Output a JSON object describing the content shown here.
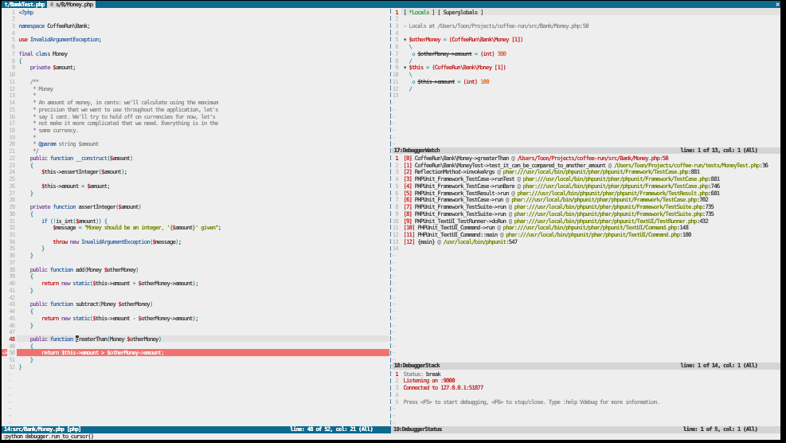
{
  "colors": {
    "accent_blue_bar": "#0d6a8f",
    "editor_bg": "#eeeeee",
    "cursorline_bg": "#e2e2e2",
    "break_line_bg": "#f0716f",
    "inactive_bar_bg": "#d5d5d5",
    "text_fg": "#4a4a4b",
    "comment_gray": "#8e908c",
    "red": "#c82829",
    "green": "#718c00",
    "locals_green": "#35a14b",
    "blue": "#4271ae",
    "purple": "#8959a8",
    "aqua": "#3e99ae",
    "orange": "#e0702d",
    "line_number": "#aeaeae",
    "nontext_tilde": "#b9c2ea",
    "vert_split": "#4e81a0",
    "tree_branch": "#5b8cc4"
  },
  "tabline": {
    "tabs": [
      {
        "label": "t/BankTest.php",
        "active": false
      },
      {
        "win_count": "4",
        "label": "s/B/Money.php",
        "active": true
      }
    ],
    "close_label": "X"
  },
  "code_window": {
    "cursor_line": 48,
    "break_line": 50,
    "tilde_rows": 8,
    "lines": [
      [
        [
          "blu",
          "<?php"
        ]
      ],
      [],
      [
        [
          "blu",
          "namespace"
        ],
        [
          "fg",
          " CoffeeRun\\Bank;"
        ]
      ],
      [],
      [
        [
          "red",
          "use"
        ],
        [
          "blu",
          " InvalidArgumentException"
        ],
        [
          "fg",
          ";"
        ]
      ],
      [],
      [
        [
          "pur",
          "final "
        ],
        [
          "blu",
          "class"
        ],
        [
          "fg",
          " Money"
        ]
      ],
      [
        [
          "aqu",
          "{"
        ]
      ],
      [
        [
          "fg",
          "    "
        ],
        [
          "pur",
          "private"
        ],
        [
          "fg",
          " "
        ],
        [
          "red",
          "$"
        ],
        [
          "fg",
          "amount;"
        ]
      ],
      [],
      [
        [
          "com",
          "    /**"
        ]
      ],
      [
        [
          "com",
          "     * Money"
        ]
      ],
      [
        [
          "com",
          "     *"
        ]
      ],
      [
        [
          "com",
          "     * An amount of money, in cents: we'll calculate using the maximum"
        ]
      ],
      [
        [
          "com",
          "     * precision that we want to use throughout the application, let's"
        ]
      ],
      [
        [
          "com",
          "     * say 1 cent. We'll try to hold off on currencies for now, let's"
        ]
      ],
      [
        [
          "com",
          "     * not make it more complicated that we need. Everything is in the"
        ]
      ],
      [
        [
          "com",
          "     * same currency."
        ]
      ],
      [
        [
          "com",
          "     *"
        ]
      ],
      [
        [
          "com",
          "     * "
        ],
        [
          "blu",
          "@param"
        ],
        [
          "com",
          " string $amount"
        ]
      ],
      [
        [
          "com",
          "     */"
        ]
      ],
      [
        [
          "fg",
          "    "
        ],
        [
          "pur",
          "public"
        ],
        [
          "fg",
          " "
        ],
        [
          "blu",
          "function __construct"
        ],
        [
          "aqu",
          "("
        ],
        [
          "red",
          "$"
        ],
        [
          "fg",
          "amount"
        ],
        [
          "aqu",
          ")"
        ]
      ],
      [
        [
          "fg",
          "    "
        ],
        [
          "aqu",
          "{"
        ]
      ],
      [
        [
          "fg",
          "        "
        ],
        [
          "red",
          "$"
        ],
        [
          "fg",
          "this->assertInteger"
        ],
        [
          "aqu",
          "("
        ],
        [
          "red",
          "$"
        ],
        [
          "fg",
          "amount"
        ],
        [
          "aqu",
          ")"
        ],
        [
          "fg",
          ";"
        ]
      ],
      [],
      [
        [
          "fg",
          "        "
        ],
        [
          "red",
          "$"
        ],
        [
          "fg",
          "this->amount"
        ],
        [
          "aqu",
          " = "
        ],
        [
          "red",
          "$"
        ],
        [
          "fg",
          "amount;"
        ]
      ],
      [
        [
          "fg",
          "    "
        ],
        [
          "aqu",
          "}"
        ]
      ],
      [],
      [
        [
          "fg",
          "    "
        ],
        [
          "pur",
          "private"
        ],
        [
          "fg",
          " "
        ],
        [
          "blu",
          "function"
        ],
        [
          "fg",
          " assertInteger"
        ],
        [
          "aqu",
          "("
        ],
        [
          "red",
          "$"
        ],
        [
          "fg",
          "amount"
        ],
        [
          "aqu",
          ")"
        ]
      ],
      [
        [
          "fg",
          "    "
        ],
        [
          "aqu",
          "{"
        ]
      ],
      [
        [
          "fg",
          "        "
        ],
        [
          "blu",
          "if"
        ],
        [
          "fg",
          " "
        ],
        [
          "aqu",
          "(!"
        ],
        [
          "fg",
          "is_int"
        ],
        [
          "aqu",
          "("
        ],
        [
          "red",
          "$"
        ],
        [
          "fg",
          "amount"
        ],
        [
          "aqu",
          "))"
        ],
        [
          "fg",
          " "
        ],
        [
          "aqu",
          "{"
        ]
      ],
      [
        [
          "fg",
          "            "
        ],
        [
          "red",
          "$"
        ],
        [
          "fg",
          "message"
        ],
        [
          "aqu",
          " = "
        ],
        [
          "grn",
          "\"Money should be an integer, '{"
        ],
        [
          "red",
          "$"
        ],
        [
          "fg",
          "amount"
        ],
        [
          "grn",
          "}' given\""
        ],
        [
          "fg",
          ";"
        ]
      ],
      [],
      [
        [
          "fg",
          "            "
        ],
        [
          "red",
          "throw"
        ],
        [
          "fg",
          " "
        ],
        [
          "pur",
          "new"
        ],
        [
          "fg",
          " "
        ],
        [
          "blu",
          "InvalidArgumentException"
        ],
        [
          "aqu",
          "("
        ],
        [
          "red",
          "$"
        ],
        [
          "fg",
          "message"
        ],
        [
          "aqu",
          ")"
        ],
        [
          "fg",
          ";"
        ]
      ],
      [
        [
          "fg",
          "        "
        ],
        [
          "aqu",
          "}"
        ]
      ],
      [
        [
          "fg",
          "    "
        ],
        [
          "aqu",
          "}"
        ]
      ],
      [],
      [
        [
          "fg",
          "    "
        ],
        [
          "pur",
          "public"
        ],
        [
          "fg",
          " "
        ],
        [
          "blu",
          "function"
        ],
        [
          "fg",
          " add"
        ],
        [
          "aqu",
          "("
        ],
        [
          "fg",
          "Money "
        ],
        [
          "red",
          "$"
        ],
        [
          "fg",
          "otherMoney"
        ],
        [
          "aqu",
          ")"
        ]
      ],
      [
        [
          "fg",
          "    "
        ],
        [
          "aqu",
          "{"
        ]
      ],
      [
        [
          "fg",
          "        "
        ],
        [
          "red",
          "return"
        ],
        [
          "fg",
          " "
        ],
        [
          "pur",
          "new"
        ],
        [
          "fg",
          " "
        ],
        [
          "blu",
          "static"
        ],
        [
          "aqu",
          "("
        ],
        [
          "red",
          "$"
        ],
        [
          "fg",
          "this->amount"
        ],
        [
          "aqu",
          " + "
        ],
        [
          "red",
          "$"
        ],
        [
          "fg",
          "otherMoney->amount"
        ],
        [
          "aqu",
          ")"
        ],
        [
          "fg",
          ";"
        ]
      ],
      [
        [
          "fg",
          "    "
        ],
        [
          "aqu",
          "}"
        ]
      ],
      [],
      [
        [
          "fg",
          "    "
        ],
        [
          "pur",
          "public"
        ],
        [
          "fg",
          " "
        ],
        [
          "blu",
          "function"
        ],
        [
          "fg",
          " subtract"
        ],
        [
          "aqu",
          "("
        ],
        [
          "fg",
          "Money "
        ],
        [
          "red",
          "$"
        ],
        [
          "fg",
          "otherMoney"
        ],
        [
          "aqu",
          ")"
        ]
      ],
      [
        [
          "fg",
          "    "
        ],
        [
          "aqu",
          "{"
        ]
      ],
      [
        [
          "fg",
          "        "
        ],
        [
          "red",
          "return"
        ],
        [
          "fg",
          " "
        ],
        [
          "pur",
          "new"
        ],
        [
          "fg",
          " "
        ],
        [
          "blu",
          "static"
        ],
        [
          "aqu",
          "("
        ],
        [
          "red",
          "$"
        ],
        [
          "fg",
          "this->amount"
        ],
        [
          "aqu",
          " - "
        ],
        [
          "red",
          "$"
        ],
        [
          "fg",
          "otherMoney->amount"
        ],
        [
          "aqu",
          ")"
        ],
        [
          "fg",
          ";"
        ]
      ],
      [
        [
          "fg",
          "    "
        ],
        [
          "aqu",
          "}"
        ]
      ],
      [],
      [
        [
          "fg",
          "    "
        ],
        [
          "pur",
          "public"
        ],
        [
          "fg",
          " "
        ],
        [
          "blu",
          "function"
        ],
        [
          "fg",
          " "
        ],
        [
          "cur",
          "g"
        ],
        [
          "fg",
          "reaterThan"
        ],
        [
          "aqu",
          "("
        ],
        [
          "fg",
          "Money "
        ],
        [
          "red",
          "$"
        ],
        [
          "fg",
          "otherMoney"
        ],
        [
          "aqu",
          ")"
        ]
      ],
      [
        [
          "fg",
          "    "
        ],
        [
          "aqu",
          "{"
        ]
      ],
      [
        [
          "wht",
          "        return $this->amount > $otherMoney->amount;"
        ]
      ],
      [
        [
          "fg",
          "    "
        ],
        [
          "aqu",
          "}"
        ]
      ],
      [
        [
          "aqu",
          "}"
        ]
      ]
    ],
    "status": {
      "left": "14:src/Bank/Money.php [php]",
      "right": "line: 48 of 52, col: 21 (All)"
    }
  },
  "watch_window": {
    "cursor_line": 1,
    "cursor_band": true,
    "tilde_rows": 7,
    "lines": [
      [
        [
          "fg",
          "[ "
        ],
        [
          "gr2",
          "*Locals"
        ],
        [
          "fg",
          " ] [ Superglobals ]"
        ]
      ],
      [],
      [
        [
          "com",
          "- Locals at /Users/Toon/Projects/coffee-run/src/Bank/Money.php:50"
        ]
      ],
      [],
      [
        [
          "fg",
          "▾ "
        ],
        [
          "red",
          "$otherMoney"
        ],
        [
          "aqu",
          " = "
        ],
        [
          "red",
          "(CoffeeRun\\Bank\\Money [1])"
        ]
      ],
      [
        [
          "tre",
          "  \\"
        ]
      ],
      [
        [
          "aqu",
          "   ◇ "
        ],
        [
          "stk",
          "$otherMoney->amount"
        ],
        [
          "aqu",
          " = "
        ],
        [
          "red",
          "(int)"
        ],
        [
          "orn",
          " 300"
        ]
      ],
      [
        [
          "tre",
          "  /"
        ]
      ],
      [
        [
          "fg",
          "▾ "
        ],
        [
          "red",
          "$this"
        ],
        [
          "aqu",
          " = "
        ],
        [
          "red",
          "(CoffeeRun\\Bank\\Money [1])"
        ]
      ],
      [
        [
          "tre",
          "  \\"
        ]
      ],
      [
        [
          "aqu",
          "   ◇ "
        ],
        [
          "stk",
          "$this->amount"
        ],
        [
          "aqu",
          " = "
        ],
        [
          "red",
          "(int)"
        ],
        [
          "orn",
          " 100"
        ]
      ],
      [
        [
          "tre",
          "  /"
        ]
      ],
      []
    ],
    "status": {
      "left": "17:DebuggerWatch",
      "right": "line: 1 of 13, col: 1 (All)"
    }
  },
  "stack_window": {
    "cursor_line": 1,
    "cursor_band": false,
    "tilde_rows": 16,
    "lines": [
      [
        [
          "red",
          "[0]"
        ],
        [
          "fg",
          " CoffeeRun\\Bank\\Money->greaterThan"
        ],
        [
          "com",
          " @ "
        ],
        [
          "red",
          "/Users/Toon/Projects/coffee-run/src/Bank/Money.php:50"
        ]
      ],
      [
        [
          "red",
          "[1]"
        ],
        [
          "fg",
          " CoffeeRun\\Bank\\MoneyTest->test_it_can_be_compared_to_another_amount"
        ],
        [
          "com",
          " @ "
        ],
        [
          "grn",
          "/Users/Toon/Projects/coffee-run/tests/MoneyTest.php"
        ],
        [
          "fg",
          ":36"
        ]
      ],
      [
        [
          "red",
          "[2]"
        ],
        [
          "fg",
          " ReflectionMethod->invokeArgs"
        ],
        [
          "com",
          " @ "
        ],
        [
          "grn",
          "phar:///usr/local/bin/phpunit/phar/phpunit/Framework/TestCase.php"
        ],
        [
          "fg",
          ":881"
        ]
      ],
      [
        [
          "red",
          "[3]"
        ],
        [
          "fg",
          " PHPUnit_Framework_TestCase->runTest"
        ],
        [
          "com",
          " @ "
        ],
        [
          "grn",
          "phar:///usr/local/bin/phpunit/phar/phpunit/Framework/TestCase.php"
        ],
        [
          "fg",
          ":881"
        ]
      ],
      [
        [
          "red",
          "[4]"
        ],
        [
          "fg",
          " PHPUnit_Framework_TestCase->runBare"
        ],
        [
          "com",
          " @ "
        ],
        [
          "grn",
          "phar:///usr/local/bin/phpunit/phar/phpunit/Framework/TestCase.php"
        ],
        [
          "fg",
          ":746"
        ]
      ],
      [
        [
          "red",
          "[5]"
        ],
        [
          "fg",
          " PHPUnit_Framework_TestResult->run"
        ],
        [
          "com",
          " @ "
        ],
        [
          "grn",
          "phar:///usr/local/bin/phpunit/phar/phpunit/Framework/TestResult.php"
        ],
        [
          "fg",
          ":601"
        ]
      ],
      [
        [
          "red",
          "[6]"
        ],
        [
          "fg",
          " PHPUnit_Framework_TestCase->run"
        ],
        [
          "com",
          " @ "
        ],
        [
          "grn",
          "phar:///usr/local/bin/phpunit/phar/phpunit/Framework/TestCase.php"
        ],
        [
          "fg",
          ":702"
        ]
      ],
      [
        [
          "red",
          "[7]"
        ],
        [
          "fg",
          " PHPUnit_Framework_TestSuite->run"
        ],
        [
          "com",
          " @ "
        ],
        [
          "grn",
          "phar:///usr/local/bin/phpunit/phar/phpunit/Framework/TestSuite.php"
        ],
        [
          "fg",
          ":735"
        ]
      ],
      [
        [
          "red",
          "[8]"
        ],
        [
          "fg",
          " PHPUnit_Framework_TestSuite->run"
        ],
        [
          "com",
          " @ "
        ],
        [
          "grn",
          "phar:///usr/local/bin/phpunit/phar/phpunit/Framework/TestSuite.php"
        ],
        [
          "fg",
          ":735"
        ]
      ],
      [
        [
          "red",
          "[9]"
        ],
        [
          "fg",
          " PHPUnit_TextUI_TestRunner->doRun"
        ],
        [
          "com",
          " @ "
        ],
        [
          "grn",
          "phar:///usr/local/bin/phpunit/phar/phpunit/TextUI/TestRunner.php"
        ],
        [
          "fg",
          ":432"
        ]
      ],
      [
        [
          "red",
          "[10]"
        ],
        [
          "fg",
          " PHPUnit_TextUI_Command->run"
        ],
        [
          "com",
          " @ "
        ],
        [
          "grn",
          "phar:///usr/local/bin/phpunit/phar/phpunit/TextUI/Command.php"
        ],
        [
          "fg",
          ":148"
        ]
      ],
      [
        [
          "red",
          "[11]"
        ],
        [
          "fg",
          " PHPUnit_TextUI_Command::main"
        ],
        [
          "com",
          " @ "
        ],
        [
          "grn",
          "phar:///usr/local/bin/phpunit/phar/phpunit/TextUI/Command.php"
        ],
        [
          "fg",
          ":100"
        ]
      ],
      [
        [
          "red",
          "[12]"
        ],
        [
          "fg",
          " {main}"
        ],
        [
          "com",
          " @ "
        ],
        [
          "grn",
          "/usr/local/bin/phpunit"
        ],
        [
          "fg",
          ":547"
        ]
      ],
      []
    ],
    "status": {
      "left": "18:DebuggerStack",
      "right": "line: 1 of 14, col: 1 (All)"
    }
  },
  "status_window": {
    "cursor_line": 1,
    "cursor_band": false,
    "tilde_rows": 3,
    "lines": [
      [
        [
          "com",
          "Status: "
        ],
        [
          "fg",
          "break"
        ]
      ],
      [
        [
          "red",
          "Listening on :9000"
        ]
      ],
      [
        [
          "red",
          "Connected to 127.0.0.1:51877"
        ]
      ],
      [],
      [
        [
          "com",
          "Press <F5> to start debugging, <F6> to stop/close. Type :help Vdebug for more information."
        ]
      ]
    ],
    "status": {
      "left": "19:DebuggerStatus",
      "right": "line: 1 of 5, col: 1 (All)"
    }
  },
  "cmdline": ":python debugger.run_to_cursor()"
}
